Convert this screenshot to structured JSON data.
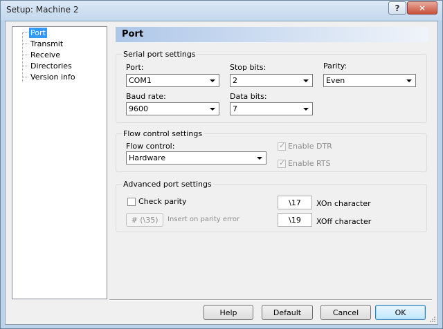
{
  "window": {
    "title": "Setup: Machine 2",
    "help_glyph": "?",
    "close_glyph": "✕"
  },
  "tree": {
    "items": [
      {
        "label": "Port",
        "selected": true
      },
      {
        "label": "Transmit",
        "selected": false
      },
      {
        "label": "Receive",
        "selected": false
      },
      {
        "label": "Directories",
        "selected": false
      },
      {
        "label": "Version info",
        "selected": false
      }
    ]
  },
  "page": {
    "title": "Port"
  },
  "serial": {
    "group_label": "Serial port settings",
    "port": {
      "label": "Port:",
      "value": "COM1"
    },
    "stop_bits": {
      "label": "Stop bits:",
      "value": "2"
    },
    "parity": {
      "label": "Parity:",
      "value": "Even"
    },
    "baud_rate": {
      "label": "Baud rate:",
      "value": "9600"
    },
    "data_bits": {
      "label": "Data bits:",
      "value": "7"
    }
  },
  "flow": {
    "group_label": "Flow control settings",
    "flow_control": {
      "label": "Flow control:",
      "value": "Hardware"
    },
    "enable_dtr": {
      "label": "Enable DTR",
      "checked": true,
      "enabled": false
    },
    "enable_rts": {
      "label": "Enable RTS",
      "checked": true,
      "enabled": false
    }
  },
  "advanced": {
    "group_label": "Advanced port settings",
    "check_parity": {
      "label": "Check parity",
      "checked": false
    },
    "parity_error_button": "# (\\35)",
    "parity_error_label": "Insert on parity error",
    "xon": {
      "value": "\\17",
      "label": "XOn character"
    },
    "xoff": {
      "value": "\\19",
      "label": "XOff character"
    }
  },
  "buttons": {
    "help": "Help",
    "default": "Default",
    "cancel": "Cancel",
    "ok": "OK"
  },
  "colors": {
    "selection": "#3399ff",
    "header_gradient_start": "#aec7e8",
    "close_button": "#c7503a"
  }
}
